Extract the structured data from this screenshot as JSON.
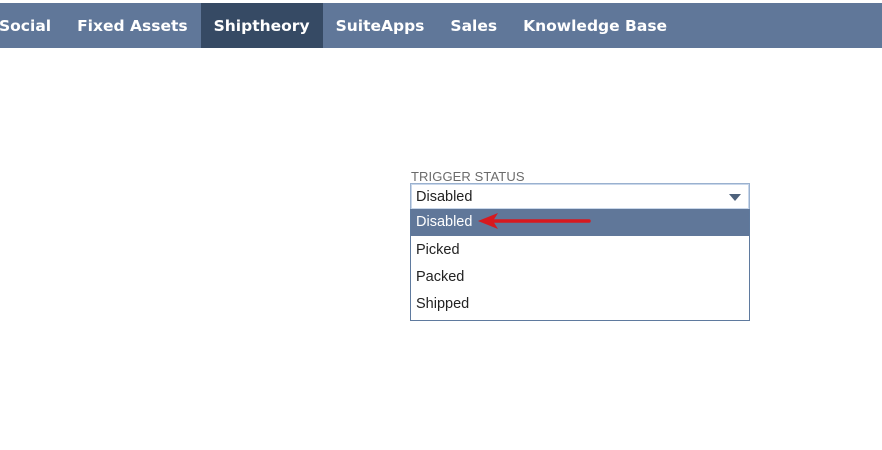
{
  "nav": {
    "items": [
      {
        "label": "Social",
        "active": false
      },
      {
        "label": "Fixed Assets",
        "active": false
      },
      {
        "label": "Shiptheory",
        "active": true
      },
      {
        "label": "SuiteApps",
        "active": false
      },
      {
        "label": "Sales",
        "active": false
      },
      {
        "label": "Knowledge Base",
        "active": false
      }
    ]
  },
  "field": {
    "label": "TRIGGER STATUS",
    "value": "Disabled",
    "options": [
      "Disabled",
      "Picked",
      "Packed",
      "Shipped"
    ],
    "selected_index": 0
  },
  "annotation": {
    "arrow_icon": "red-arrow-left-icon",
    "color": "#d7191f"
  },
  "colors": {
    "nav_bg": "#607799",
    "nav_active_bg": "#364a64",
    "option_selected_bg": "#607799"
  }
}
